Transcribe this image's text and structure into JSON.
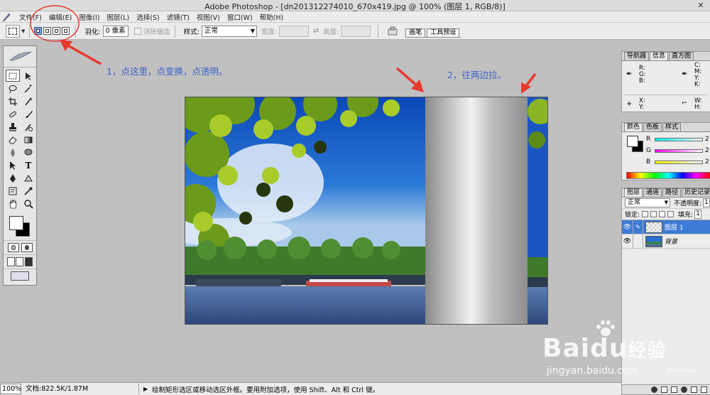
{
  "window": {
    "title": "Adobe Photoshop - [dn201312274010_670x419.jpg @ 100% (图层 1, RGB/8)]"
  },
  "menu": [
    "文件(F)",
    "编辑(E)",
    "图像(I)",
    "图层(L)",
    "选择(S)",
    "滤镜(T)",
    "视图(V)",
    "窗口(W)",
    "帮助(H)"
  ],
  "options": {
    "feather_label": "羽化:",
    "feather_value": "0 像素",
    "antialias_label": "消除锯齿",
    "style_label": "样式:",
    "style_value": "正常",
    "width_label": "宽度:",
    "height_label": "高度:",
    "palette_tabs": [
      "画笔",
      "工具预设"
    ]
  },
  "annotations": {
    "step1": "1，点这里，点变换，点透明。",
    "step2": "2，往两边拉。"
  },
  "colors": {
    "annotation": "#3d62c9",
    "arrow": "#e8392f",
    "selected_layer": "#3e7bd6"
  },
  "info_panel": {
    "tabs": [
      "导航器",
      "信息",
      "直方图"
    ],
    "active_tab": "信息",
    "rgb_labels": "R:\nG:\nB:",
    "cmyk_labels": "C:\nM:\nY:\nK:",
    "xy_labels": "X:\nY:",
    "wh_labels": "W:\nH:"
  },
  "color_panel": {
    "tabs": [
      "颜色",
      "色板",
      "样式"
    ],
    "active_tab": "颜色",
    "channels": [
      {
        "name": "R",
        "value": "2"
      },
      {
        "name": "G",
        "value": "2"
      },
      {
        "name": "B",
        "value": "2"
      }
    ]
  },
  "layers_panel": {
    "tabs": [
      "图层",
      "通道",
      "路径",
      "历史记录"
    ],
    "active_tab": "图层",
    "blend_mode": "正常",
    "opacity_label": "不透明度:",
    "opacity_value": "1",
    "lock_label": "锁定:",
    "fill_label": "填充:",
    "fill_value": "1",
    "layers": [
      {
        "name": "图层 1",
        "selected": true
      },
      {
        "name": "背景",
        "selected": false
      }
    ]
  },
  "status": {
    "zoom": "100%",
    "doc": "文档:822.5K/1.87M",
    "hint": "绘制矩形选区或移动选区外框。要用附加选项，使用 Shift、Alt 和 Ctrl 键。"
  },
  "watermark": {
    "brand": "Bai",
    "brand2": "du",
    "brand_cn": "经验",
    "url": "jingyan.baidu.com",
    "activate": "Windows。"
  }
}
